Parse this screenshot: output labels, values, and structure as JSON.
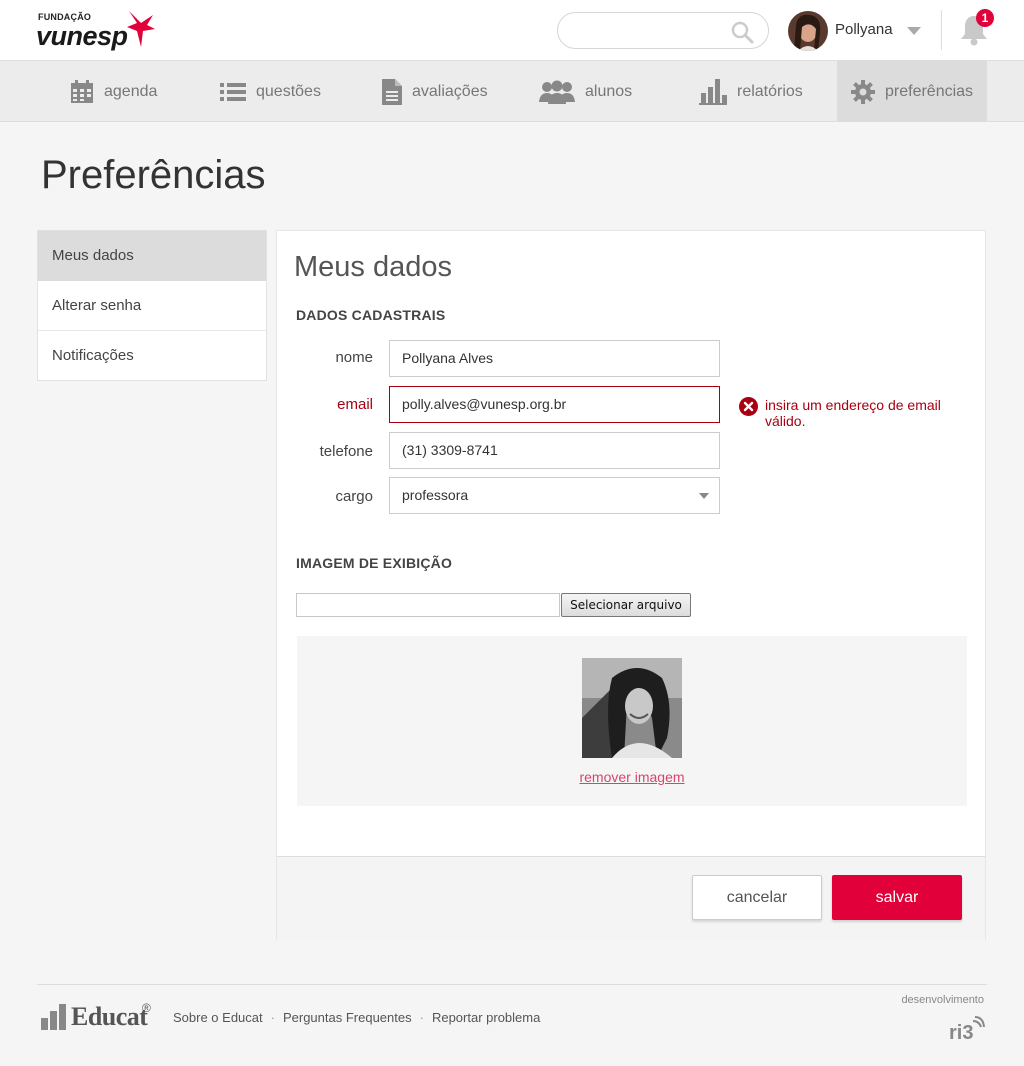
{
  "brand": {
    "small": "FUNDAÇÃO",
    "name": "vunesp",
    "accent": "#e2003a"
  },
  "search": {
    "placeholder": ""
  },
  "user": {
    "name": "Pollyana"
  },
  "notifications": {
    "count": "1"
  },
  "nav": [
    {
      "label": "agenda",
      "icon": "calendar-icon"
    },
    {
      "label": "questões",
      "icon": "list-icon"
    },
    {
      "label": "avaliações",
      "icon": "document-icon"
    },
    {
      "label": "alunos",
      "icon": "users-icon"
    },
    {
      "label": "relatórios",
      "icon": "bar-chart-icon"
    },
    {
      "label": "preferências",
      "icon": "gear-icon",
      "active": true
    }
  ],
  "page": {
    "title": "Preferências"
  },
  "side_menu": [
    {
      "label": "Meus dados",
      "active": true
    },
    {
      "label": "Alterar senha"
    },
    {
      "label": "Notificações"
    }
  ],
  "panel": {
    "title": "Meus dados",
    "section_registration": "DADOS CADASTRAIS",
    "fields": {
      "nome": {
        "label": "nome",
        "value": "Pollyana Alves"
      },
      "email": {
        "label": "email",
        "value": "polly.alves@vunesp.org.br",
        "error": "insira um endereço de email válido."
      },
      "telefone": {
        "label": "telefone",
        "value": "(31) 3309-8741"
      },
      "cargo": {
        "label": "cargo",
        "value": "professora"
      }
    },
    "section_image": "IMAGEM DE EXIBIÇÃO",
    "file_button": "Selecionar arquivo",
    "remove_image": "remover imagem",
    "cancel": "cancelar",
    "save": "salvar"
  },
  "footer": {
    "brand": "Educat",
    "registered": "®",
    "links": [
      "Sobre o Educat",
      "Perguntas Frequentes",
      "Reportar problema"
    ],
    "dev_label": "desenvolvimento"
  }
}
